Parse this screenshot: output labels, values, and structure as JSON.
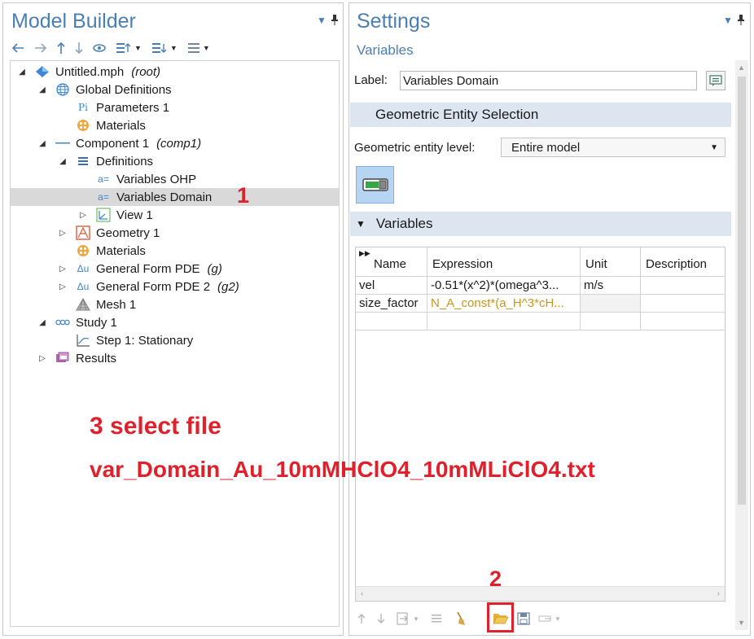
{
  "model_builder": {
    "title": "Model Builder",
    "toolbar": [
      "back-arrow",
      "forward-arrow",
      "up-arrow",
      "down-arrow",
      "show-icon",
      "expand-sections",
      "collapse-sections",
      "list-view"
    ],
    "tree": [
      {
        "label": "Untitled.mph",
        "tag": "(root)",
        "level": 0,
        "expander": "expanded",
        "icon": "model-icon"
      },
      {
        "label": "Global Definitions",
        "tag": "",
        "level": 1,
        "expander": "expanded",
        "icon": "globe-icon"
      },
      {
        "label": "Parameters 1",
        "tag": "",
        "level": 2,
        "expander": "",
        "icon": "parameters-icon",
        "icon_text": "Pi"
      },
      {
        "label": "Materials",
        "tag": "",
        "level": 2,
        "expander": "",
        "icon": "materials-icon"
      },
      {
        "label": "Component 1",
        "tag": "(comp1)",
        "level": 1,
        "expander": "expanded",
        "icon": "component-icon"
      },
      {
        "label": "Definitions",
        "tag": "",
        "level": 2,
        "expander": "expanded",
        "icon": "definitions-icon"
      },
      {
        "label": "Variables OHP",
        "tag": "",
        "level": 3,
        "expander": "",
        "icon": "variables-icon",
        "icon_text": "a="
      },
      {
        "label": "Variables Domain",
        "tag": "",
        "level": 3,
        "expander": "",
        "icon": "variables-icon",
        "icon_text": "a=",
        "selected": true
      },
      {
        "label": "View 1",
        "tag": "",
        "level": 3,
        "expander": "collapsed",
        "icon": "view-icon"
      },
      {
        "label": "Geometry 1",
        "tag": "",
        "level": 2,
        "expander": "collapsed",
        "icon": "geometry-icon"
      },
      {
        "label": "Materials",
        "tag": "",
        "level": 2,
        "expander": "",
        "icon": "materials-icon"
      },
      {
        "label": "General Form PDE",
        "tag": "(g)",
        "level": 2,
        "expander": "collapsed",
        "icon": "pde-icon",
        "icon_text": "Δu"
      },
      {
        "label": "General Form PDE 2",
        "tag": "(g2)",
        "level": 2,
        "expander": "collapsed",
        "icon": "pde-icon",
        "icon_text": "Δu"
      },
      {
        "label": "Mesh 1",
        "tag": "",
        "level": 2,
        "expander": "",
        "icon": "mesh-icon"
      },
      {
        "label": "Study 1",
        "tag": "",
        "level": 1,
        "expander": "expanded",
        "icon": "study-icon"
      },
      {
        "label": "Step 1: Stationary",
        "tag": "",
        "level": 2,
        "expander": "",
        "icon": "stationary-step-icon"
      },
      {
        "label": "Results",
        "tag": "",
        "level": 1,
        "expander": "collapsed",
        "icon": "results-icon"
      }
    ]
  },
  "settings": {
    "title": "Settings",
    "subtitle": "Variables",
    "label_caption": "Label:",
    "label_value": "Variables Domain",
    "section_geo": "Geometric Entity Selection",
    "entity_level_caption": "Geometric entity level:",
    "entity_level_value": "Entire model",
    "section_vars": "Variables",
    "table": {
      "headers": [
        "Name",
        "Expression",
        "Unit",
        "Description"
      ],
      "rows": [
        {
          "name": "vel",
          "expression": "-0.51*(x^2)*(omega^3...",
          "unit": "m/s",
          "description": ""
        },
        {
          "name": "size_factor",
          "expression": "N_A_const*(a_H^3*cH...",
          "unit": "",
          "description": ""
        }
      ]
    },
    "bottom_toolbar": [
      "move-up-icon",
      "move-down-icon",
      "insert-icon",
      "clear-icon",
      "broom-icon",
      "open-folder-icon",
      "save-icon",
      "more-icon"
    ]
  },
  "annotations": {
    "step1": "1",
    "step2": "2",
    "step3_line1": "3 select file",
    "step3_line2": "var_Domain_Au_10mMHClO4_10mMLiClO4.txt"
  },
  "colors": {
    "title_blue": "#4a7fb5",
    "annotation_red": "#e0202a",
    "section_bg": "#dde6f0",
    "selected_row": "#d9d9d9",
    "expression_orange": "#c8951e"
  }
}
